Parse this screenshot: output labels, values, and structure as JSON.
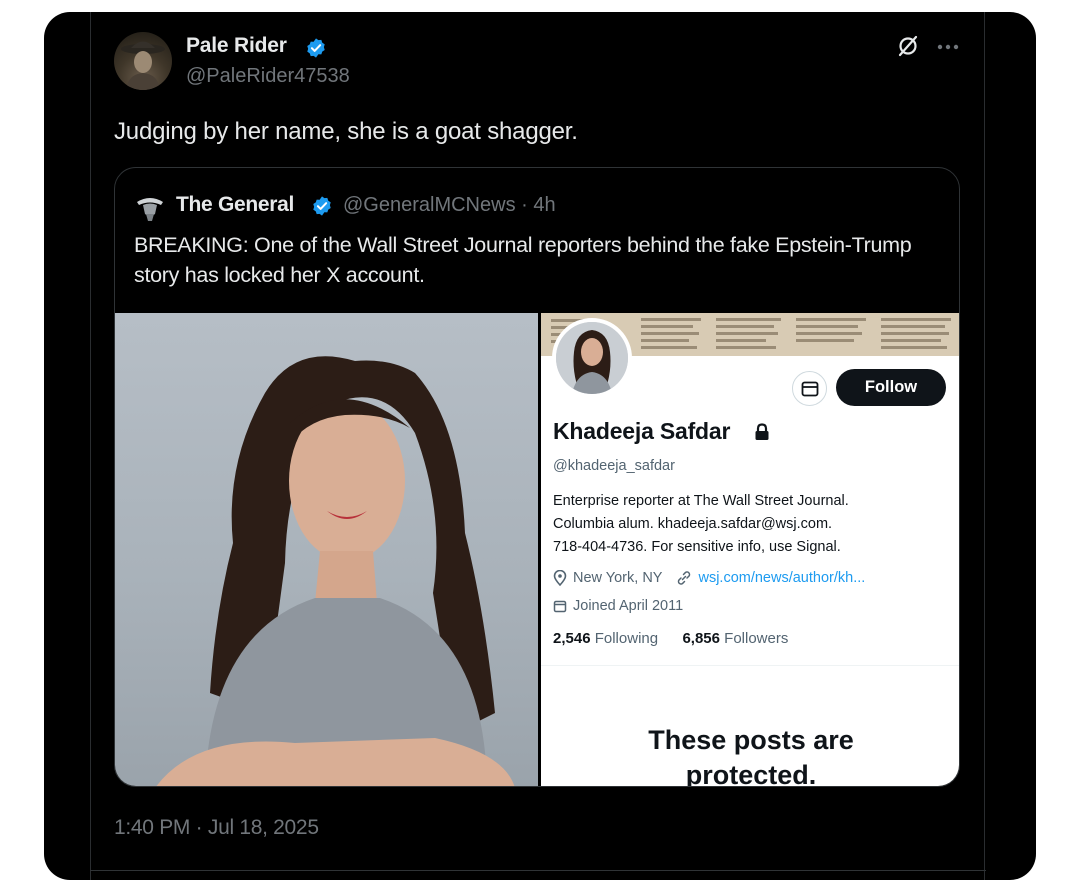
{
  "tweet": {
    "author_name": "Pale Rider",
    "author_handle": "@PaleRider47538",
    "text": "Judging by her name, she is a goat shagger.",
    "timestamp": "1:40 PM · Jul 18, 2025",
    "icons": [
      "verified-badge-icon",
      "grok-icon",
      "more-icon"
    ]
  },
  "quote": {
    "author_name": "The General",
    "author_handle_time": "@GeneralMCNews · 4h",
    "text": "BREAKING: One of the Wall Street Journal reporters behind the fake Epstein-Trump story has locked her X account."
  },
  "profile_card": {
    "follow_label": "Follow",
    "name": "Khadeeja Safdar",
    "handle": "@khadeeja_safdar",
    "bio_lines": [
      "Enterprise reporter at The Wall Street Journal.",
      "Columbia alum.  khadeeja.safdar@wsj.com.",
      "718-404-4736. For sensitive info, use Signal."
    ],
    "location": "New York, NY",
    "website": "wsj.com/news/author/kh...",
    "joined": "Joined April 2011",
    "following_count": "2,546",
    "following_label": "Following",
    "followers_count": "6,856",
    "followers_label": "Followers",
    "protected_line1": "These posts are",
    "protected_line2": "protected."
  },
  "colors": {
    "background": "#000000",
    "text_primary": "#e7e9ea",
    "text_secondary": "#71767b",
    "verified_blue": "#1d9bf0",
    "follow_button": "#0f1419"
  }
}
